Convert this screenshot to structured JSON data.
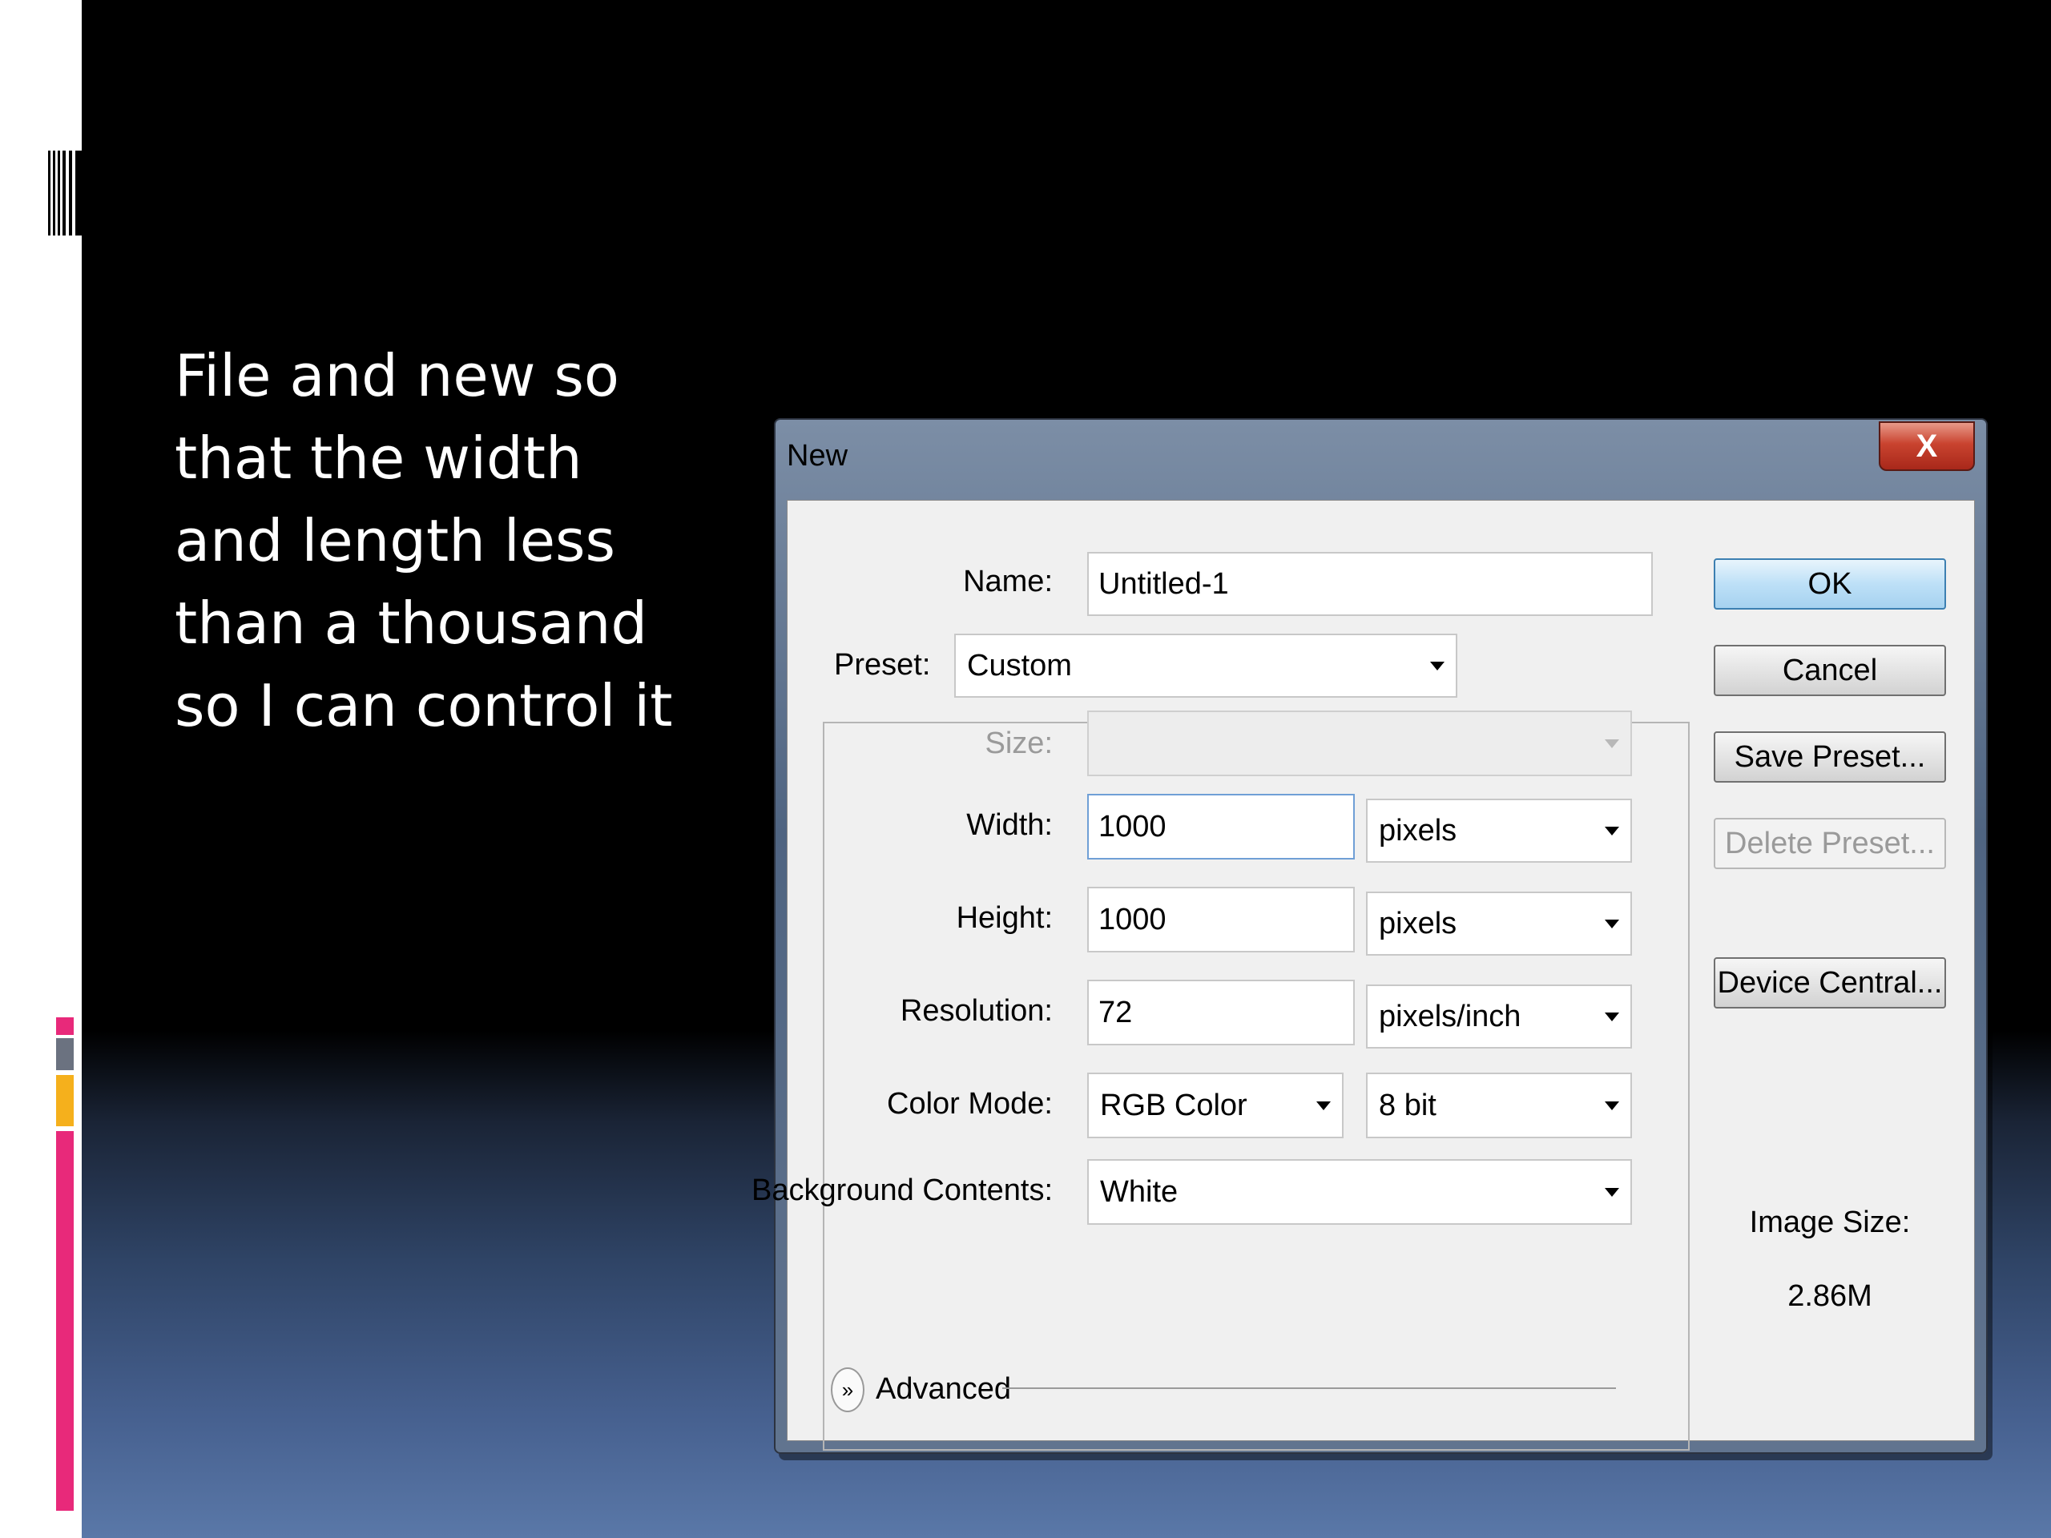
{
  "slide": {
    "text": "File and new so\nthat the width\nand length less\nthan a thousand\nso I can control it"
  },
  "dialog": {
    "title": "New",
    "close_label": "X",
    "name_label": "Name:",
    "name_value": "Untitled-1",
    "preset_label": "Preset:",
    "preset_value": "Custom",
    "size_label": "Size:",
    "size_value": "",
    "width_label": "Width:",
    "width_value": "1000",
    "width_unit": "pixels",
    "height_label": "Height:",
    "height_value": "1000",
    "height_unit": "pixels",
    "resolution_label": "Resolution:",
    "resolution_value": "72",
    "resolution_unit": "pixels/inch",
    "color_mode_label": "Color Mode:",
    "color_mode_value": "RGB Color",
    "bit_depth_value": "8 bit",
    "background_label": "Background Contents:",
    "background_value": "White",
    "advanced_label": "Advanced",
    "buttons": {
      "ok": "OK",
      "cancel": "Cancel",
      "save_preset": "Save Preset...",
      "delete_preset": "Delete Preset...",
      "device_central": "Device Central..."
    },
    "image_size_label": "Image Size:",
    "image_size_value": "2.86M"
  },
  "colors": {
    "accent_pink": "#e8297a",
    "accent_gray": "#6b7280",
    "accent_yellow": "#f5b01c"
  }
}
